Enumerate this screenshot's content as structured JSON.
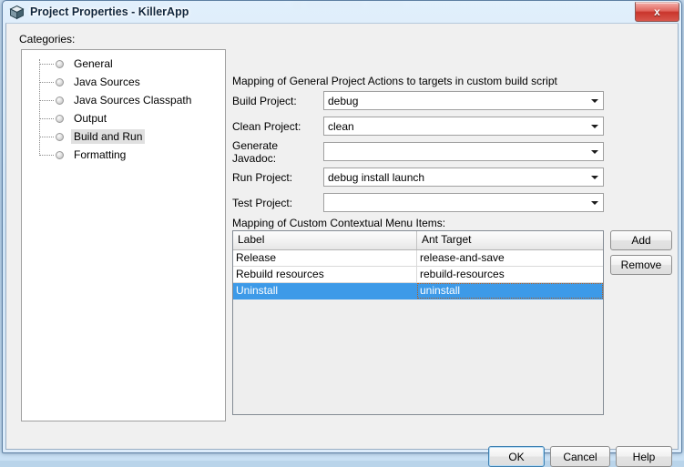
{
  "window": {
    "title": "Project Properties - KillerApp",
    "icon": "cube-icon",
    "close_label": "x",
    "accent_selection": "#3d9ae8",
    "focus_outline": "#b35c1e"
  },
  "categories": {
    "label": "Categories:",
    "items": [
      {
        "label": "General",
        "selected": false
      },
      {
        "label": "Java Sources",
        "selected": false
      },
      {
        "label": "Java Sources Classpath",
        "selected": false
      },
      {
        "label": "Output",
        "selected": false
      },
      {
        "label": "Build and Run",
        "selected": true
      },
      {
        "label": "Formatting",
        "selected": false
      }
    ]
  },
  "main": {
    "section_title": "Mapping of General Project Actions to targets in custom build script",
    "fields": [
      {
        "label": "Build Project:",
        "value": "debug"
      },
      {
        "label": "Clean Project:",
        "value": "clean"
      },
      {
        "label": "Generate Javadoc:",
        "value": ""
      },
      {
        "label": "Run Project:",
        "value": "debug install launch"
      },
      {
        "label": "Test Project:",
        "value": ""
      }
    ],
    "table": {
      "title": "Mapping of Custom Contextual Menu Items:",
      "columns": [
        "Label",
        "Ant Target"
      ],
      "rows": [
        {
          "label": "Release",
          "target": "release-and-save",
          "selected": false
        },
        {
          "label": "Rebuild resources",
          "target": "rebuild-resources",
          "selected": false
        },
        {
          "label": "Uninstall",
          "target": "uninstall",
          "selected": true
        }
      ]
    },
    "side_buttons": {
      "add": "Add",
      "remove": "Remove"
    }
  },
  "footer": {
    "ok": "OK",
    "cancel": "Cancel",
    "help": "Help"
  }
}
